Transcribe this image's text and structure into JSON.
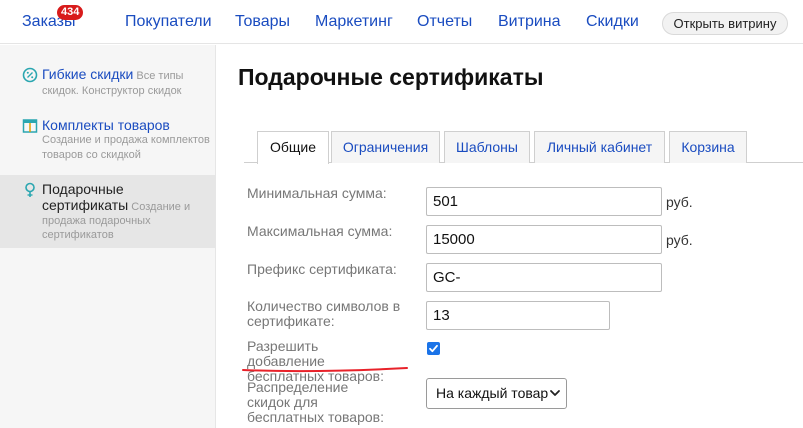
{
  "nav": {
    "items": [
      "Заказы",
      "Покупатели",
      "Товары",
      "Маркетинг",
      "Отчеты",
      "Витрина",
      "Скидки"
    ],
    "orders_badge": "434",
    "open_storefront": "Открыть витрину"
  },
  "sidebar": {
    "items": [
      {
        "title": "Гибкие скидки",
        "desc": "Все типы скидок. Конструктор скидок",
        "icon": "percent-circle-icon"
      },
      {
        "title": "Комплекты товаров",
        "desc": "Создание и продажа комплектов товаров со скидкой",
        "icon": "product-set-icon"
      },
      {
        "title": "Подарочные сертификаты",
        "desc": "Создание и продажа подарочных сертификатов",
        "icon": "gift-certificate-icon"
      }
    ]
  },
  "page": {
    "title": "Подарочные сертификаты",
    "tabs": [
      "Общие",
      "Ограничения",
      "Шаблоны",
      "Личный кабинет",
      "Корзина"
    ],
    "active_tab": "Общие"
  },
  "form": {
    "min_sum_label": "Минимальная сумма:",
    "min_sum_value": "501",
    "max_sum_label": "Максимальная сумма:",
    "max_sum_value": "15000",
    "currency": "руб.",
    "prefix_label": "Префикс сертификата:",
    "prefix_value": "GC-",
    "chars_label": "Количество символов в сертификате:",
    "chars_value": "13",
    "allow_free_label": "Разрешить добавление бесплатных товаров:",
    "allow_free_checked": true,
    "distribution_label": "Распределение скидок для бесплатных товаров:",
    "distribution_value": "На каждый товар"
  },
  "colors": {
    "link": "#1a4cc0",
    "badge": "#d81b1b",
    "checkbox": "#1a73e8",
    "annotation": "#e8222a"
  }
}
